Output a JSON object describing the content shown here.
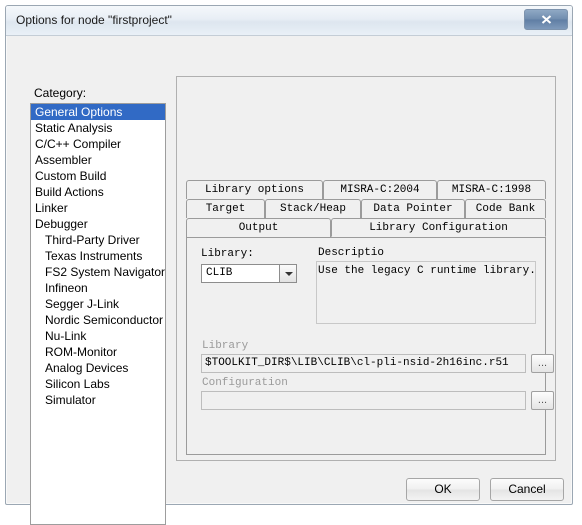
{
  "window": {
    "title": "Options for node \"firstproject\"",
    "close_label": "close-icon"
  },
  "category": {
    "label": "Category:",
    "items": [
      {
        "label": "General Options",
        "selected": true,
        "indent": false
      },
      {
        "label": "Static Analysis",
        "selected": false,
        "indent": false
      },
      {
        "label": "C/C++ Compiler",
        "selected": false,
        "indent": false
      },
      {
        "label": "Assembler",
        "selected": false,
        "indent": false
      },
      {
        "label": "Custom Build",
        "selected": false,
        "indent": false
      },
      {
        "label": "Build Actions",
        "selected": false,
        "indent": false
      },
      {
        "label": "Linker",
        "selected": false,
        "indent": false
      },
      {
        "label": "Debugger",
        "selected": false,
        "indent": false
      },
      {
        "label": "Third-Party Driver",
        "selected": false,
        "indent": true
      },
      {
        "label": "Texas Instruments",
        "selected": false,
        "indent": true
      },
      {
        "label": "FS2 System Navigator",
        "selected": false,
        "indent": true
      },
      {
        "label": "Infineon",
        "selected": false,
        "indent": true
      },
      {
        "label": "Segger J-Link",
        "selected": false,
        "indent": true
      },
      {
        "label": "Nordic Semiconductor",
        "selected": false,
        "indent": true
      },
      {
        "label": "Nu-Link",
        "selected": false,
        "indent": true
      },
      {
        "label": "ROM-Monitor",
        "selected": false,
        "indent": true
      },
      {
        "label": "Analog Devices",
        "selected": false,
        "indent": true
      },
      {
        "label": "Silicon Labs",
        "selected": false,
        "indent": true
      },
      {
        "label": "Simulator",
        "selected": false,
        "indent": true
      }
    ]
  },
  "tabs": {
    "row1": [
      {
        "label": "Library options",
        "active": false
      },
      {
        "label": "MISRA-C:2004",
        "active": false
      },
      {
        "label": "MISRA-C:1998",
        "active": false
      }
    ],
    "row2": [
      {
        "label": "Target",
        "active": false
      },
      {
        "label": "Stack/Heap",
        "active": false
      },
      {
        "label": "Data Pointer",
        "active": false
      },
      {
        "label": "Code Bank",
        "active": false
      }
    ],
    "row3": [
      {
        "label": "Output",
        "active": false
      },
      {
        "label": "Library Configuration",
        "active": true
      }
    ]
  },
  "panel": {
    "library_label": "Library:",
    "library_value": "CLIB",
    "description_label": "Descriptio",
    "description_text": "Use the legacy C runtime library.",
    "library_path_label": "Library",
    "library_path_value": "$TOOLKIT_DIR$\\LIB\\CLIB\\cl-pli-nsid-2h16inc.r51",
    "library_browse_label": "...",
    "configuration_label": "Configuration",
    "configuration_value": "",
    "configuration_browse_label": "..."
  },
  "buttons": {
    "ok": "OK",
    "cancel": "Cancel"
  }
}
